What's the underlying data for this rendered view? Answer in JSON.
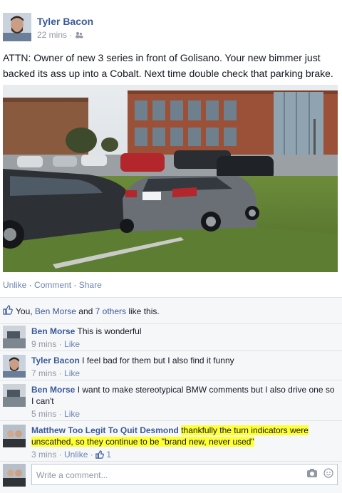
{
  "post": {
    "author": "Tyler Bacon",
    "time": "22 mins",
    "separator": "·",
    "text": "ATTN: Owner of new 3 series in front of Golisano. Your new bimmer just backed its ass up into a Cobalt. Next time double check that parking brake."
  },
  "actions": {
    "unlike": "Unlike",
    "comment": "Comment",
    "share": "Share",
    "dot": "·"
  },
  "likes": {
    "prefix": "You, ",
    "user": "Ben Morse",
    "middle": " and ",
    "others": "7 others",
    "suffix": " like this."
  },
  "comments": [
    {
      "name": "Ben Morse",
      "text": "This is wonderful",
      "time": "9 mins",
      "like": "Like"
    },
    {
      "name": "Tyler Bacon",
      "text": "I feel bad for them but I also find it funny",
      "time": "7 mins",
      "like": "Like"
    },
    {
      "name": "Ben Morse",
      "text": "I want to make stereotypical BMW comments but I also drive one so I can't",
      "time": "5 mins",
      "like": "Like"
    },
    {
      "name": "Matthew Too Legit To Quit Desmond",
      "text": "thankfully the turn indicators were unscathed, so they continue to be \"brand new, never used\"",
      "time": "3 mins",
      "like": "Unlike",
      "like_count": "1"
    }
  ],
  "composer": {
    "placeholder": "Write a comment..."
  },
  "icons": {
    "friends": "friends-icon",
    "thumb": "thumbs-up-icon",
    "camera": "camera-icon",
    "emoji": "emoji-icon"
  },
  "colors": {
    "link": "#3b5998",
    "highlight": "#ffff32",
    "meta": "#9197a3"
  }
}
